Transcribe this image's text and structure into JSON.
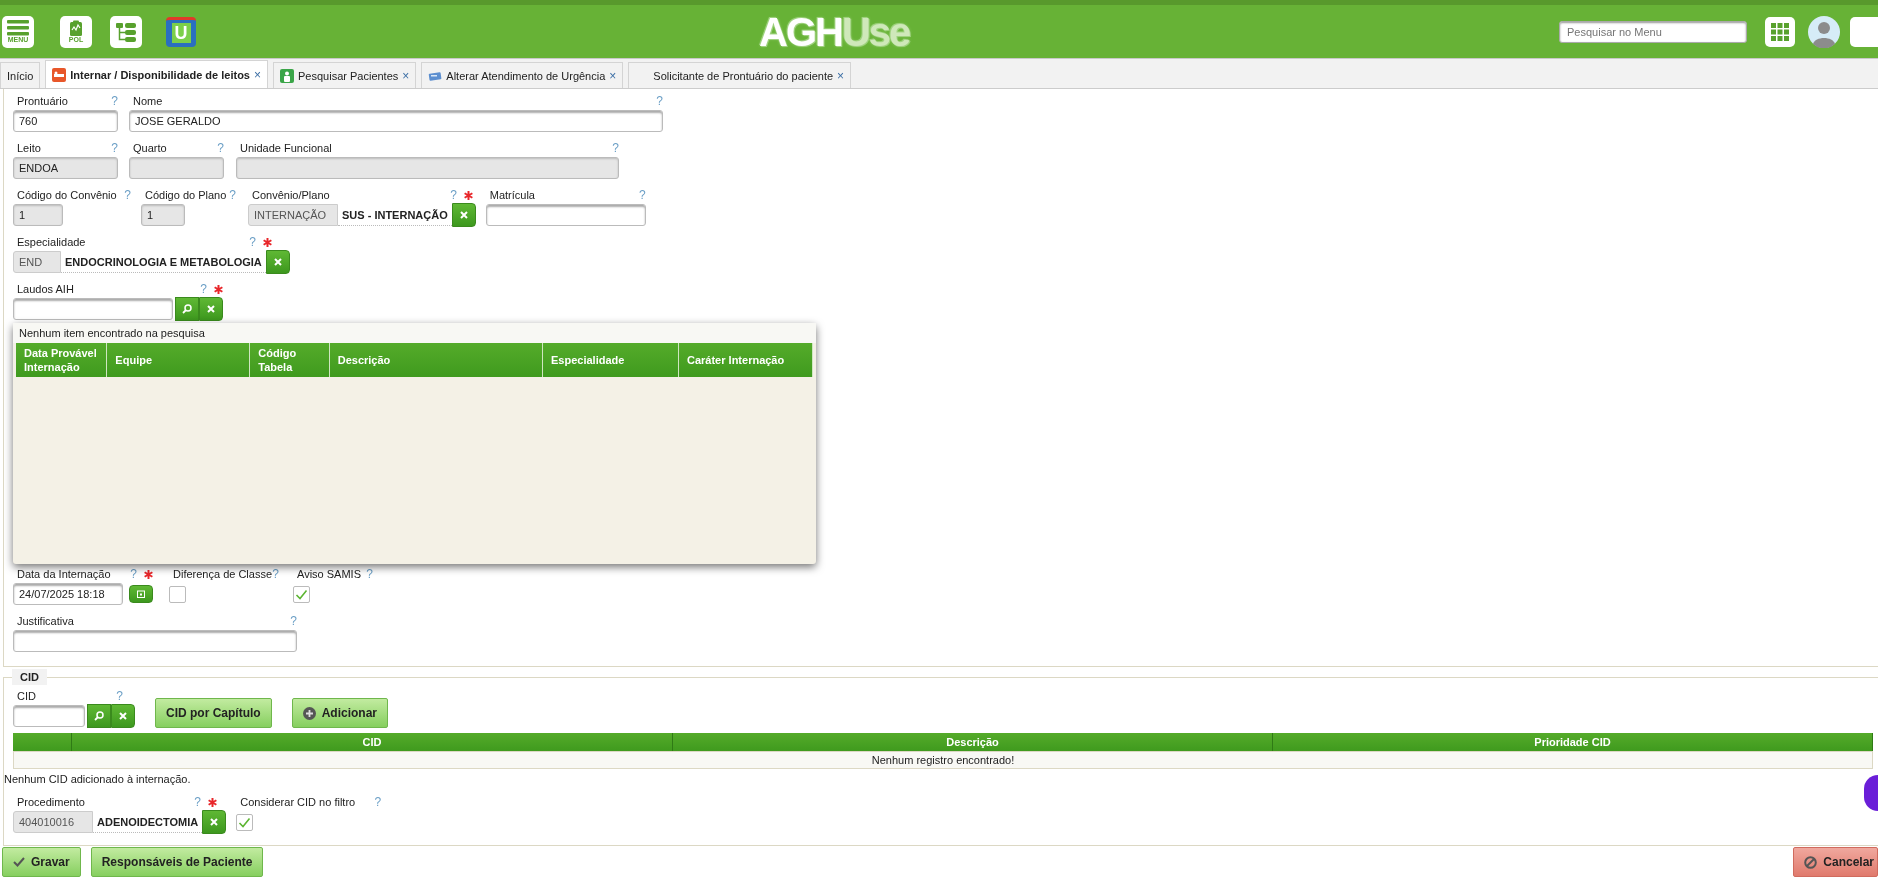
{
  "header": {
    "menu_label": "MENU",
    "pol_label": "POL",
    "app_badge": "U",
    "logo": {
      "first": "AGH",
      "second": "Use"
    },
    "search": {
      "placeholder": "Pesquisar no Menu"
    }
  },
  "tabs": [
    {
      "label": "Início",
      "selected": false,
      "kind": "home"
    },
    {
      "label": "Internar / Disponibilidade de leitos",
      "selected": true,
      "kind": "admission",
      "close": "×"
    },
    {
      "label": "Pesquisar Pacientes",
      "selected": false,
      "kind": "patients",
      "close": "×"
    },
    {
      "label": "Alterar Atendimento de Urgência",
      "selected": false,
      "kind": "urgency",
      "close": "×"
    },
    {
      "label": "Solicitante de Prontuário do paciente",
      "selected": false,
      "kind": "requester",
      "close": "×"
    }
  ],
  "form": {
    "rows": [
      [
        {
          "kind": "text",
          "label": "Prontuário",
          "help": "?",
          "value": "760",
          "disabled": false
        },
        {
          "kind": "text",
          "label": "Nome",
          "help": "?",
          "value": "JOSE GERALDO",
          "disabled": false
        }
      ],
      [
        {
          "kind": "text",
          "label": "Leito",
          "help": "?",
          "value": "ENDOA",
          "disabled": true
        },
        {
          "kind": "text",
          "label": "Quarto",
          "help": "?",
          "disabled": true
        },
        {
          "kind": "text",
          "label": "Unidade Funcional",
          "help": "?",
          "disabled": true
        }
      ],
      [
        {
          "kind": "text",
          "label": "Código do Convênio",
          "help": "?",
          "value": "1",
          "disabled": true
        },
        {
          "kind": "text",
          "label": "Código do Plano",
          "help": "?",
          "value": "1",
          "disabled": true
        },
        {
          "kind": "lookup",
          "label": "Convênio/Plano",
          "help": "?",
          "required": true,
          "code": "INTERNAÇÃO",
          "description": "SUS - INTERNAÇÃO"
        },
        {
          "kind": "text",
          "label": "Matrícula",
          "help": "?",
          "disabled": false
        }
      ],
      [
        {
          "kind": "lookup",
          "label": "Especialidade",
          "help": "?",
          "required": true,
          "code": "END",
          "description": "ENDOCRINOLOGIA E METABOLOGIA"
        }
      ],
      [
        {
          "kind": "search",
          "label": "Laudos AIH",
          "help": "?",
          "required": true
        }
      ]
    ],
    "popup": {
      "message": "Nenhum item encontrado na pesquisa",
      "columns": [
        "Data Provável Internação",
        "Equipe",
        "Código Tabela",
        "Descrição",
        "Especialidade",
        "Caráter Internação"
      ]
    },
    "rows_after": [
      [
        {
          "kind": "date",
          "label": "Data da Internação",
          "help": "?",
          "required": true,
          "value": "24/07/2025 18:18"
        },
        {
          "kind": "checkbox",
          "label": "Diferença de Classe",
          "help": "?",
          "checked": false
        },
        {
          "kind": "checkbox",
          "label": "Aviso SAMIS",
          "help": "?",
          "checked": true
        }
      ],
      [
        {
          "kind": "text",
          "label": "Justificativa",
          "help": "?",
          "disabled": false
        }
      ]
    ]
  },
  "cid": {
    "legend": "CID",
    "field": {
      "kind": "search",
      "label": "CID",
      "help": "?"
    },
    "buttons": [
      {
        "label": "CID por Capítulo",
        "kind": "chapter"
      },
      {
        "label": "Adicionar",
        "kind": "add"
      }
    ],
    "table": {
      "columns": [
        "CID",
        "Descrição",
        "Prioridade CID"
      ],
      "empty_message": "Nenhum registro encontrado!"
    },
    "note": "Nenhum CID adicionado à internação.",
    "rows": [
      [
        {
          "kind": "lookup",
          "label": "Procedimento",
          "help": "?",
          "required": true,
          "code": "404010016",
          "description": "ADENOIDECTOMIA"
        },
        {
          "kind": "checkbox",
          "label": "Considerar CID no filtro",
          "help": "?",
          "checked": true
        }
      ]
    ]
  },
  "actions": [
    {
      "label": "Gravar",
      "kind": "save"
    },
    {
      "label": "Responsáveis de Paciente",
      "kind": "plain"
    },
    {
      "label": "Cancelar",
      "kind": "cancel"
    }
  ]
}
